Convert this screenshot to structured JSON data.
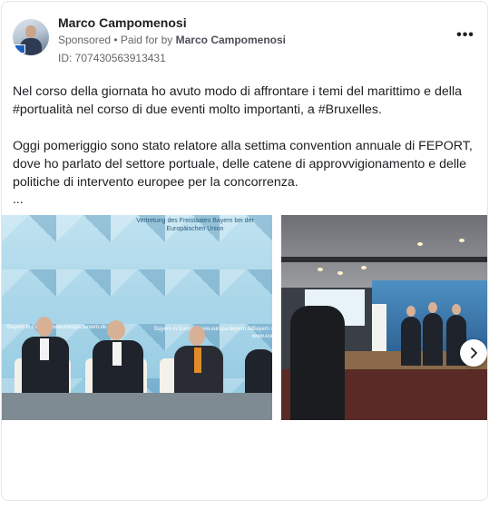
{
  "post": {
    "author": "Marco Campomenosi",
    "sponsored_label": "Sponsored",
    "paid_for_prefix": "• Paid for by",
    "paid_for_name": "Marco Campomenosi",
    "ad_id": "ID: 707430563913431",
    "more_icon": "more-options-icon",
    "paragraph1": "Nel corso della giornata ho avuto modo di affrontare i temi del marittimo e della #portualità nel corso di due eventi molto importanti, a #Bruxelles.",
    "paragraph2": "Oggi pomeriggio sono stato relatore alla settima convention annuale di FEPORT, dove ho parlato del settore portuale, delle catene di approvvigionamento e delle politiche di intervento europee per la concorrenza.",
    "ellipsis": "..."
  },
  "media": {
    "photo1": {
      "banner": "Vertretung des Freistaates Bayern bei der Europäischen Union",
      "backdrop_text_1": "Bayern in Europa www.europa.bayern.de",
      "backdrop_text_2": "Bayern in Europa www.europa.bayern.de",
      "backdrop_text_3": "Bayern in Europa www.europa.bayern.de"
    },
    "next_icon": "chevron-right-icon"
  }
}
